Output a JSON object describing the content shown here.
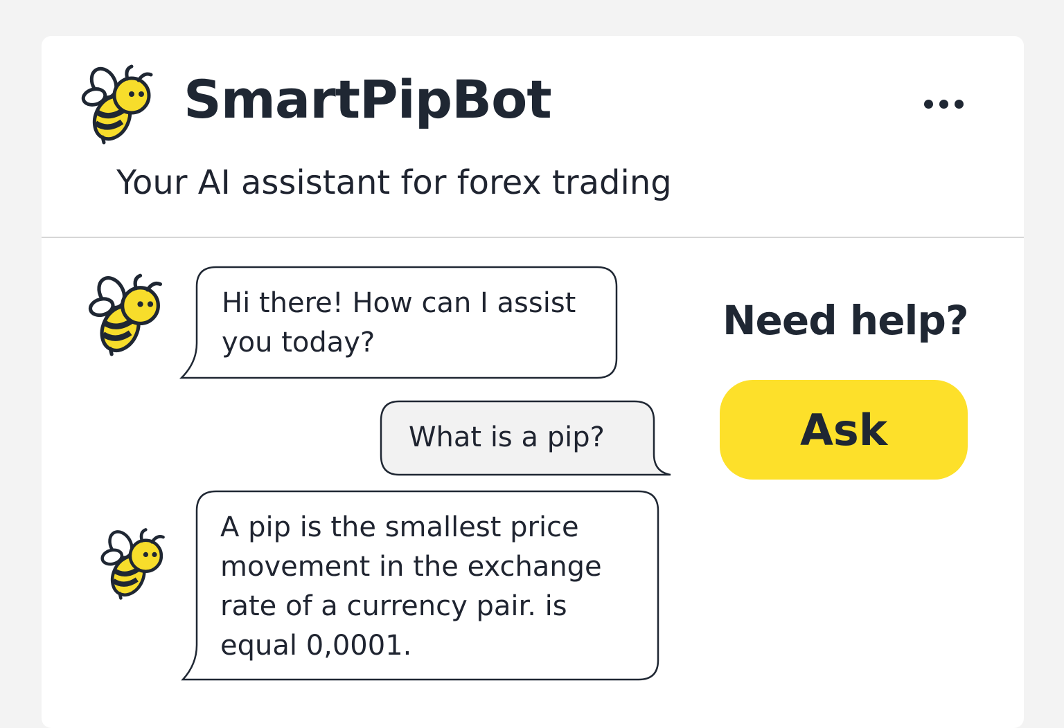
{
  "header": {
    "app_title": "SmartPipBot",
    "subtitle": "Your AI assistant for  forex trading",
    "menu_icon": "more-horizontal-icon",
    "logo_icon": "bee-icon"
  },
  "conversation": {
    "messages": [
      {
        "sender": "bot",
        "text": "Hi there! How can I assist\nyou today?"
      },
      {
        "sender": "user",
        "text": "What is a pip?"
      },
      {
        "sender": "bot",
        "text": "A pip is the smallest price\nmovement in the exchange\nrate of a currency pair. is\nequal 0,0001."
      }
    ]
  },
  "help_panel": {
    "heading": "Need help?",
    "ask_label": "Ask"
  },
  "colors": {
    "accent_yellow": "#fde02a",
    "bee_yellow": "#f7dd2b",
    "text_dark": "#1f2733",
    "user_bubble_bg": "#f2f2f2",
    "bot_bubble_bg": "#ffffff",
    "card_bg": "#ffffff",
    "page_bg": "#f3f3f3"
  }
}
